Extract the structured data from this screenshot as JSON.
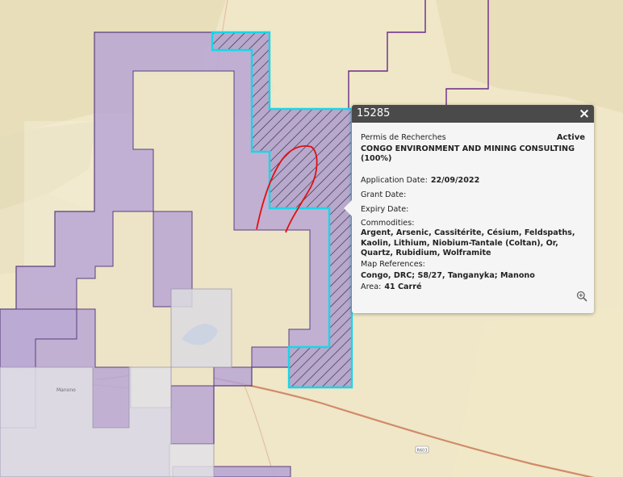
{
  "popup": {
    "title": "15285",
    "close_glyph": "×",
    "permit_type": "Permis de Recherches",
    "status": "Active",
    "company": "CONGO ENVIRONMENT AND MINING CONSULTING (100%)",
    "application_date_label": "Application Date:",
    "application_date": "22/09/2022",
    "grant_date_label": "Grant Date:",
    "grant_date": "",
    "expiry_date_label": "Expiry Date:",
    "expiry_date": "",
    "commodities_label": "Commodities:",
    "commodities": "Argent, Arsenic, Cassitérite, Césium, Feldspaths, Kaolin, Lithium, Niobium-Tantale (Coltan), Or, Quartz, Rubidium, Wolframite",
    "map_references_label": "Map References:",
    "map_references": "Congo, DRC; S8/27, Tanganyka; Manono",
    "area_label": "Area:",
    "area": "41 Carré",
    "zoom_icon": "zoom-in-icon"
  },
  "map": {
    "town_label": "Manono",
    "road_shield": "R603",
    "colors": {
      "background": "#efe7c7",
      "concession_fill": "#b8a6d3",
      "concession_stroke": "#5a3f7c",
      "selected_outline": "#19d6e8",
      "annotation": "#e01010"
    }
  }
}
